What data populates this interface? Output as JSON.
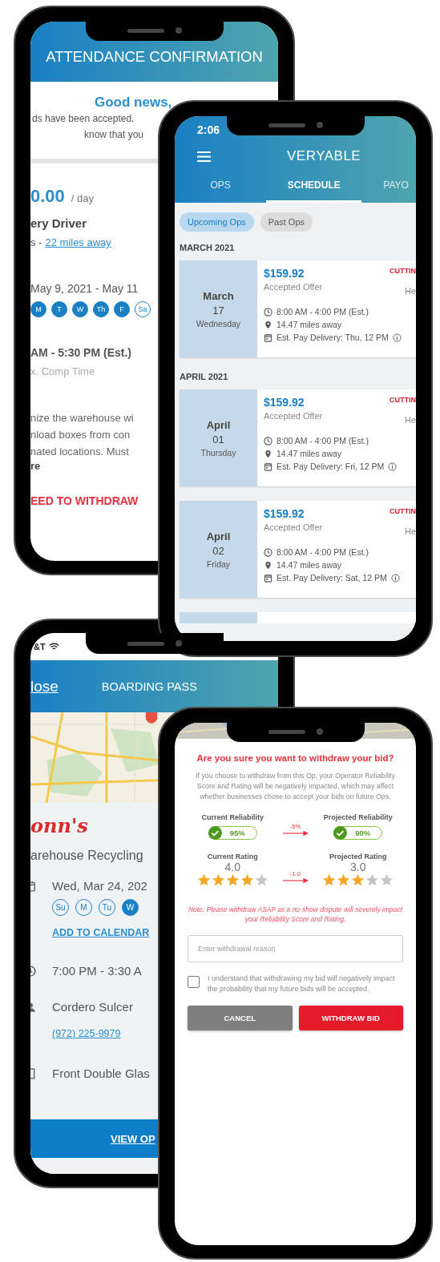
{
  "attendance_screen": {
    "title": "ATTENDANCE CONFIRMATION",
    "headline": "Good news,",
    "message_lines": [
      "ds have been accepted.",
      "know that you"
    ],
    "pay": "0.00",
    "pay_unit": "/ day",
    "job_title": "ery Driver",
    "distance_prefix": "s -",
    "distance_link": "22 miles away",
    "dates": "May 9, 2021 - May 11",
    "days": [
      {
        "label": "M",
        "selected": true
      },
      {
        "label": "T",
        "selected": true
      },
      {
        "label": "W",
        "selected": true
      },
      {
        "label": "Th",
        "selected": true
      },
      {
        "label": "F",
        "selected": true
      },
      {
        "label": "Sa",
        "selected": false
      }
    ],
    "time": "AM - 5:30 PM (Est.)",
    "comp_time": "x. Comp Time",
    "description_lines": [
      "nize the warehouse wi",
      "nload boxes from con",
      "nated locations. Must"
    ],
    "more": "re",
    "withdraw_link": "EED TO WITHDRAW"
  },
  "schedule_screen": {
    "status_time": "2:06",
    "logo": "VERYABLE",
    "tabs": [
      {
        "label": "OPS",
        "selected": false
      },
      {
        "label": "SCHEDULE",
        "selected": true
      },
      {
        "label": "PAYO",
        "selected": false
      }
    ],
    "filters": [
      {
        "label": "Upcoming Ops",
        "selected": true
      },
      {
        "label": "Past Ops",
        "selected": false
      }
    ],
    "sections": [
      {
        "heading": "MARCH 2021",
        "ops": [
          {
            "month": "March",
            "day": "17",
            "weekday": "Wednesday",
            "price": "$159.92",
            "status": "Accepted Offer",
            "tag": "CUTTIN",
            "side": "He",
            "time": "8:00 AM - 4:00 PM (Est.)",
            "distance": "14.47  miles away",
            "pay_delivery": "Est. Pay Delivery: Thu, 12 PM"
          }
        ]
      },
      {
        "heading": "APRIL 2021",
        "ops": [
          {
            "month": "April",
            "day": "01",
            "weekday": "Thursday",
            "price": "$159.92",
            "status": "Accepted Offer",
            "tag": "CUTTIN",
            "side": "He",
            "time": "8:00 AM - 4:00 PM (Est.)",
            "distance": "14.47  miles away",
            "pay_delivery": "Est. Pay Delivery: Fri, 12 PM"
          },
          {
            "month": "April",
            "day": "02",
            "weekday": "Friday",
            "price": "$159.92",
            "status": "Accepted Offer",
            "tag": "CUTTIN",
            "side": "He",
            "time": "8:00 AM - 4:00 PM (Est.)",
            "distance": "14.47  miles away",
            "pay_delivery": "Est. Pay Delivery: Sat, 12 PM"
          }
        ]
      }
    ]
  },
  "boarding_pass_screen": {
    "carrier": "&T",
    "close_link": "lose",
    "title": "BOARDING PASS",
    "logo": "onn's",
    "job": "arehouse Recycling",
    "date": "Wed, Mar 24, 202",
    "days": [
      {
        "label": "Su",
        "selected": false
      },
      {
        "label": "M",
        "selected": false
      },
      {
        "label": "Tu",
        "selected": false
      },
      {
        "label": "W",
        "selected": true
      }
    ],
    "add_to_calendar": "ADD TO CALENDAR",
    "time": "7:00 PM - 3:30 A",
    "contact": "Cordero Sulcer",
    "phone": "(972) 225-9979",
    "location": "Front Double Glas",
    "footer_link": "VIEW OP"
  },
  "withdraw_screen": {
    "title": "Are you sure you want to withdraw your bid?",
    "body": "If you choose to withdraw from this Op, your Operator Reliability Score and Rating will be negatively impacted, which may affect whether businesses chose to accept your bids on future Ops.",
    "reliability": {
      "current_label": "Current Reliability",
      "current_value": "95%",
      "change": "-5%",
      "projected_label": "Projected Reliability",
      "projected_value": "90%"
    },
    "rating": {
      "current": {
        "label": "Current Rating",
        "value": "4.0",
        "stars": 4
      },
      "change": "-1.0",
      "projected": {
        "label": "Projected Rating",
        "value": "3.0",
        "stars": 3
      }
    },
    "note": "Note: Please withdraw ASAP as a no-show dispute will severely impact your Reliability Score and Rating.",
    "reason_placeholder": "Enter withdrawal reason",
    "agreement": {
      "text": "I understand that withdrawing my bid will negatively impact the probability that my future bids will be accepted.",
      "checked": false
    },
    "buttons": [
      {
        "label": "CANCEL",
        "kind": "secondary"
      },
      {
        "label": "WITHDRAW BID",
        "kind": "danger"
      }
    ]
  }
}
